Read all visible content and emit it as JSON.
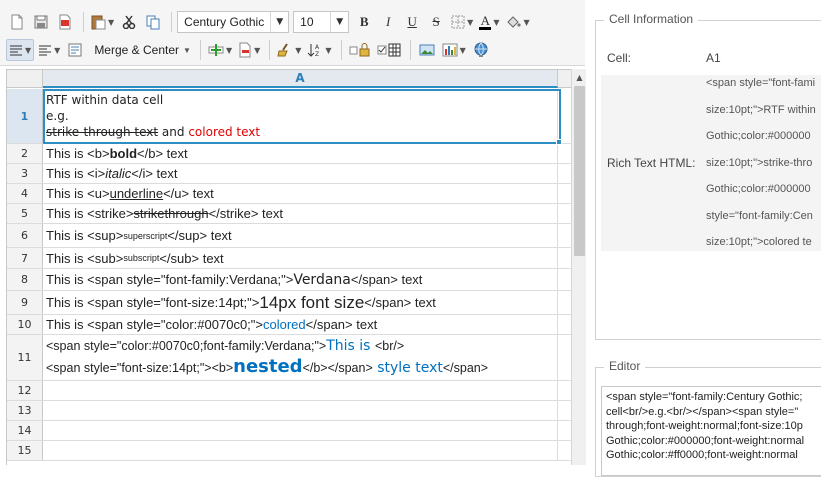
{
  "toolbar": {
    "font_family": "Century Gothic",
    "font_size": "10",
    "merge_label": "Merge & Center",
    "bold": "B",
    "italic": "I",
    "underline": "U",
    "strike": "S",
    "font_color_letter": "A"
  },
  "sheet": {
    "column_header": "A",
    "row_numbers": [
      "1",
      "2",
      "3",
      "4",
      "5",
      "6",
      "7",
      "8",
      "9",
      "10",
      "11",
      "12",
      "13",
      "14",
      "15"
    ],
    "row1": {
      "line1": "RTF within data cell",
      "line2": "e.g.",
      "strike_text": "strike-through text",
      "and": " and ",
      "colored": "colored text"
    },
    "row2": {
      "pre": "This is <b>",
      "em": "bold",
      "post": "</b> text"
    },
    "row3": {
      "pre": "This is <i>",
      "em": "italic",
      "post": "</i> text"
    },
    "row4": {
      "pre": "This is <u>",
      "em": "underline",
      "post": "</u> text"
    },
    "row5": {
      "pre": "This is <strike>",
      "em": "strikethrough",
      "post": "</strike> text"
    },
    "row6": {
      "pre": "This is <sup>",
      "em": "superscript",
      "post": "</sup> text"
    },
    "row7": {
      "pre": "This is <sub>",
      "em": "subscript",
      "post": "</sub> text"
    },
    "row8": {
      "pre": "This is <span style=\"font-family:Verdana;\">",
      "em": "Verdana",
      "post": "</span> text"
    },
    "row9": {
      "pre": "This is <span style=\"font-size:14pt;\">",
      "em": "14px font size",
      "post": "</span> text"
    },
    "row10": {
      "pre": "This is <span style=\"color:#0070c0;\">",
      "em": "colored",
      "post": "</span> text"
    },
    "row11": {
      "l1_pre": "<span style=\"color:#0070c0;font-family:Verdana;\">",
      "l1_em": "This is ",
      "l1_post": "<br/>",
      "l2_pre": "<span style=\"font-size:14pt;\"><b>",
      "l2_em": "nested",
      "l2_mid": "</b></span>",
      "l2_em2": " style text",
      "l2_post": "</span>"
    }
  },
  "cell_info": {
    "legend": "Cell Information",
    "cell_label": "Cell:",
    "cell_value": "A1",
    "rich_label": "Rich Text HTML:",
    "rich_lines": [
      "<span style=\"font-fami",
      "size:10pt;\">RTF within",
      "Gothic;color:#000000",
      "size:10pt;\">strike-thro",
      "Gothic;color:#000000",
      "style=\"font-family:Cen",
      "size:10pt;\">colored te"
    ]
  },
  "editor": {
    "legend": "Editor",
    "lines": [
      "<span style=\"font-family:Century Gothic;",
      "cell<br/>e.g.<br/></span><span style=\"",
      "through;font-weight:normal;font-size:10p",
      "Gothic;color:#000000;font-weight:normal",
      "Gothic;color:#ff0000;font-weight:normal"
    ]
  }
}
